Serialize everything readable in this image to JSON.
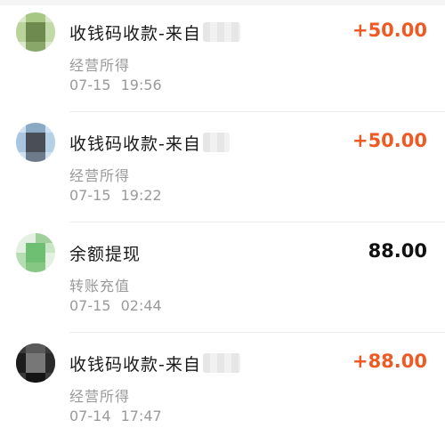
{
  "colors": {
    "income": "#ee5a24",
    "neutral": "#111111",
    "secondary_text": "#9a9a9a"
  },
  "transactions": [
    {
      "title": "收钱码收款-来自",
      "subtitle": "经营所得",
      "time": "07-15 19:56",
      "amount": "+50.00",
      "amount_type": "income",
      "avatar_icon": "pixelated-user-avatar-icon"
    },
    {
      "title": "收钱码收款-来自",
      "subtitle": "经营所得",
      "time": "07-15 19:22",
      "amount": "+50.00",
      "amount_type": "income",
      "avatar_icon": "pixelated-user-avatar-icon"
    },
    {
      "title": "余额提现",
      "subtitle": "转账充值",
      "time": "07-15 02:44",
      "amount": "88.00",
      "amount_type": "neutral",
      "avatar_icon": "pixelated-user-avatar-icon"
    },
    {
      "title": "收钱码收款-来自",
      "subtitle": "经营所得",
      "time": "07-14 17:47",
      "amount": "+88.00",
      "amount_type": "income",
      "avatar_icon": "pixelated-user-avatar-icon"
    }
  ]
}
